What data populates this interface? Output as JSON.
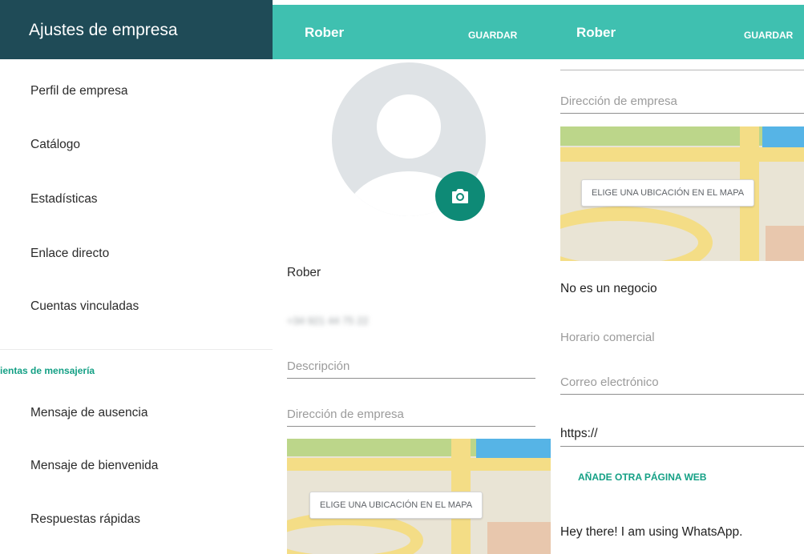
{
  "settings_panel": {
    "title": "Ajustes de empresa",
    "items": [
      {
        "label": "Perfil de empresa"
      },
      {
        "label": "Catálogo"
      },
      {
        "label": "Estadísticas"
      },
      {
        "label": "Enlace directo"
      },
      {
        "label": "Cuentas vinculadas"
      }
    ],
    "section_title": "ramientas de mensajería",
    "messaging_items": [
      {
        "label": "Mensaje de ausencia"
      },
      {
        "label": "Mensaje de bienvenida"
      },
      {
        "label": "Respuestas rápidas"
      }
    ]
  },
  "profile_panel": {
    "header_name": "Rober",
    "save_label": "GUARDAR",
    "business_name": "Rober",
    "phone": "+34 921 44 75 22",
    "description_placeholder": "Descripción",
    "address_placeholder": "Dirección de empresa",
    "map_button": "ELIGE UNA UBICACIÓN EN EL MAPA"
  },
  "profile_panel_2": {
    "header_name": "Rober",
    "save_label": "GUARDAR",
    "address_placeholder": "Dirección de empresa",
    "map_button": "ELIGE UNA UBICACIÓN EN EL MAPA",
    "category": "No es un negocio",
    "hours_placeholder": "Horario comercial",
    "email_placeholder": "Correo electrónico",
    "website_value": "https://",
    "add_website_label": "AÑADE OTRA PÁGINA WEB",
    "about": "Hey there! I am using WhatsApp."
  },
  "colors": {
    "settings_header": "#1f4b57",
    "app_bar": "#3fc0b0",
    "accent": "#14a085",
    "camera_button": "#0e8a76"
  }
}
